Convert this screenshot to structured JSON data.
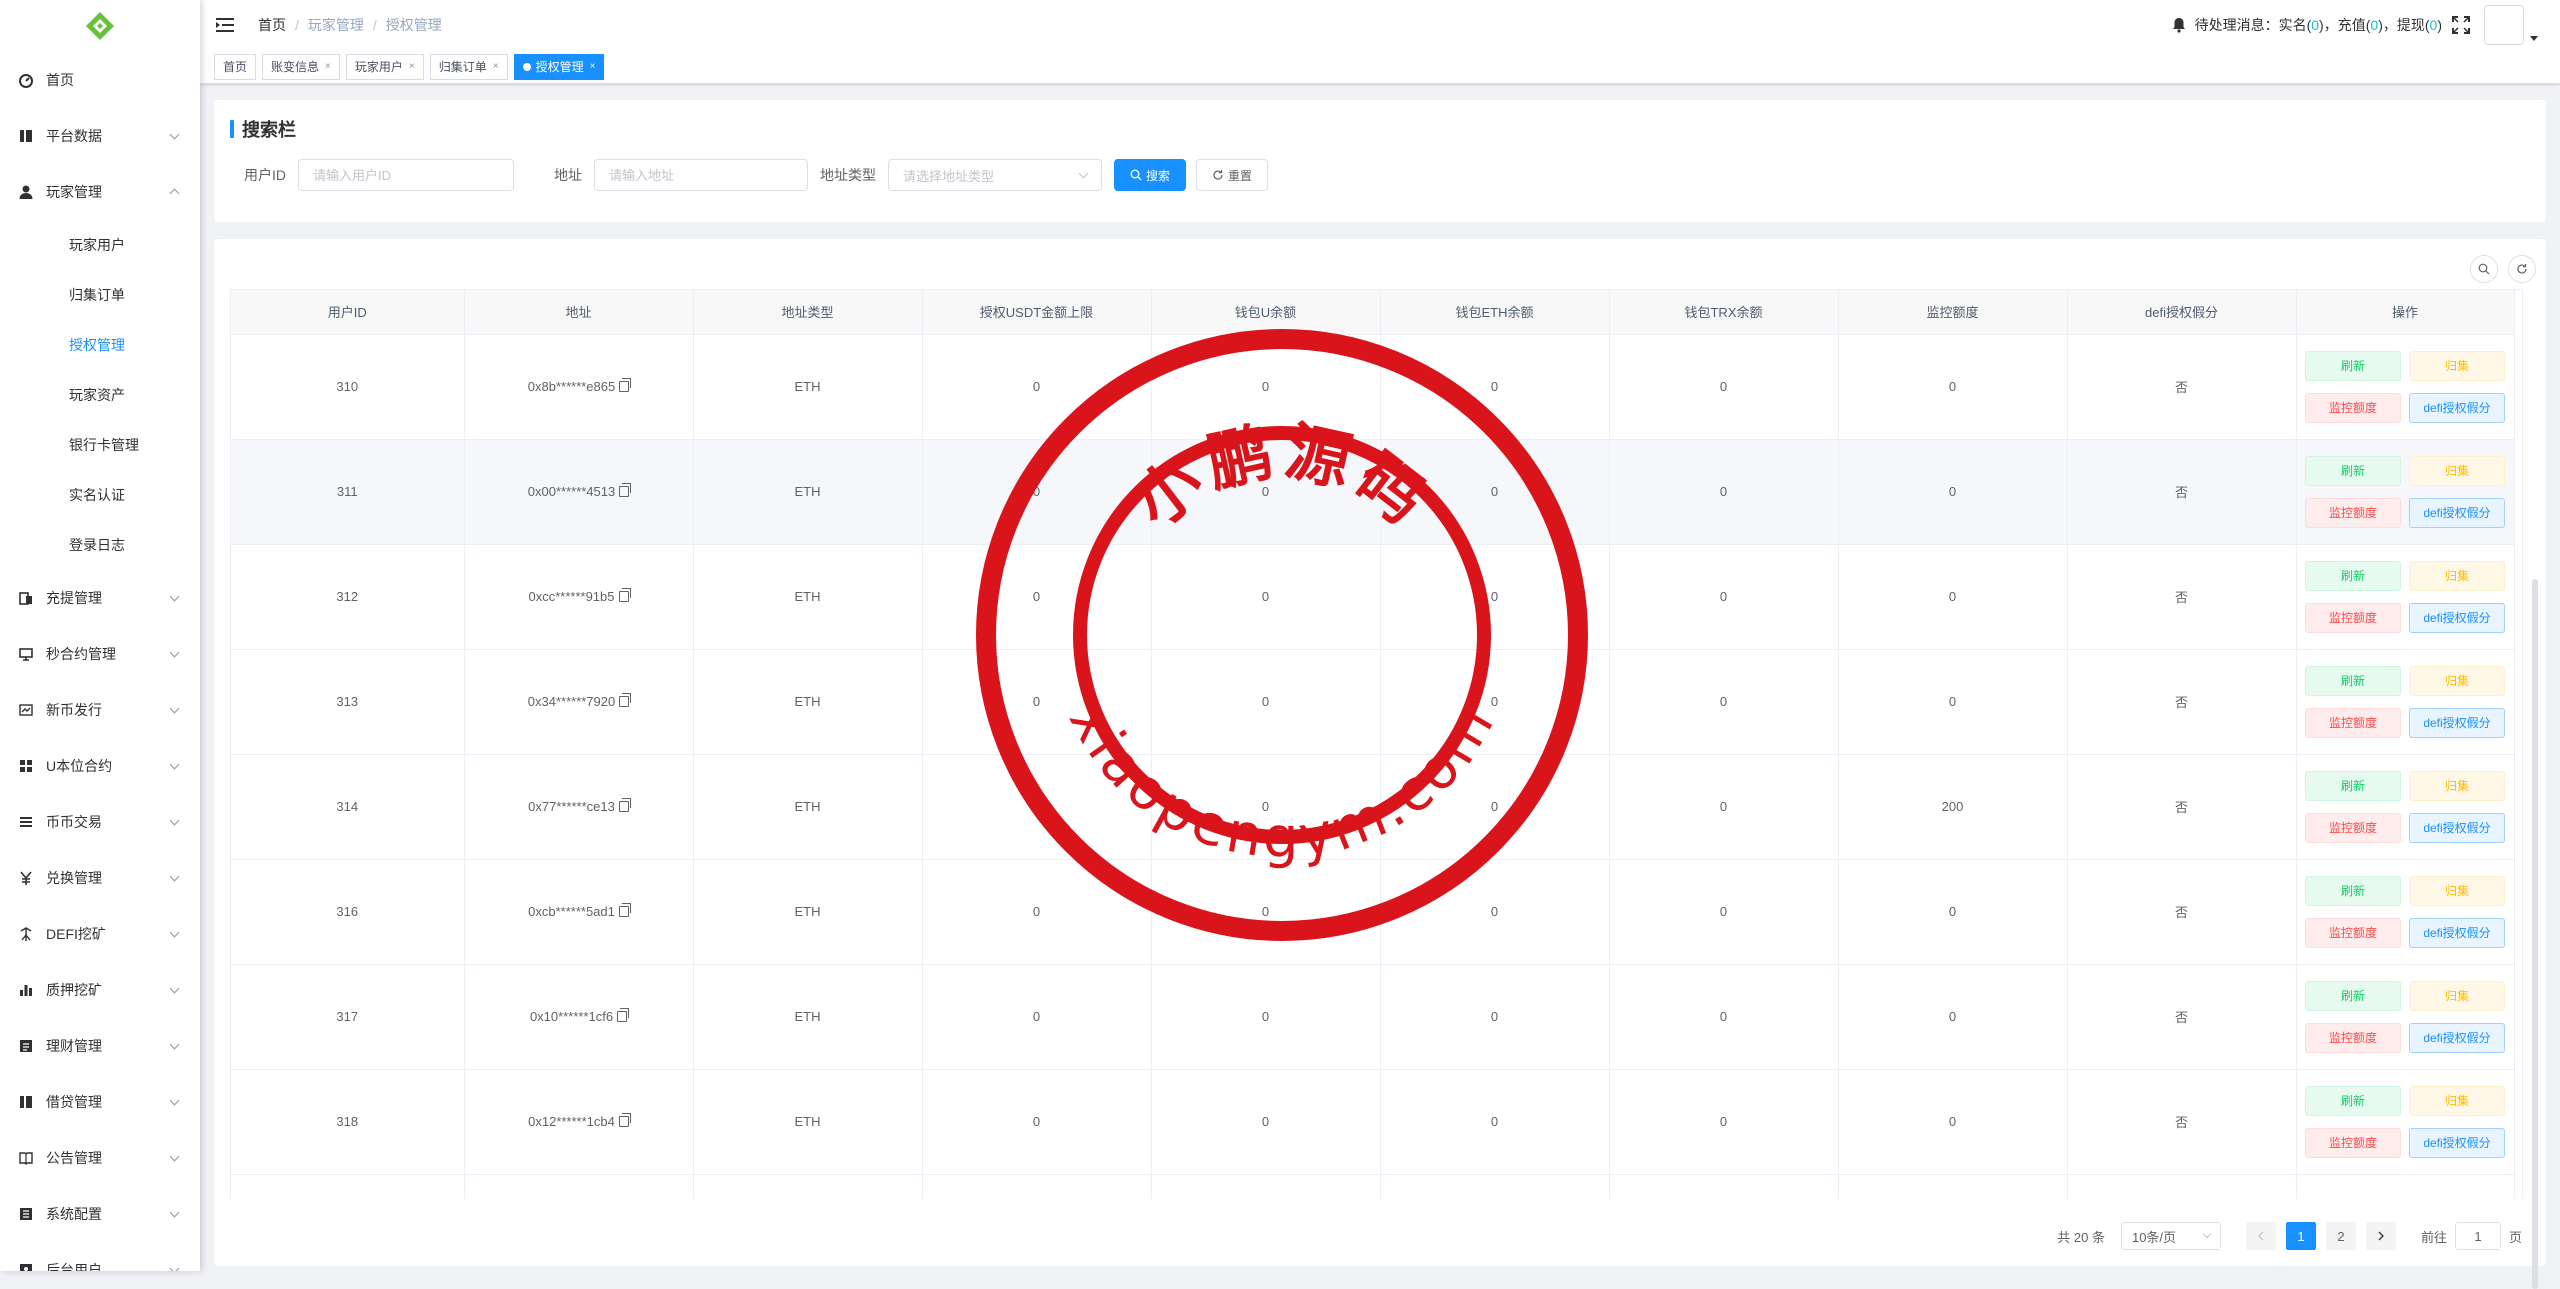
{
  "sidebar": {
    "items": [
      {
        "label": "首页",
        "icon": "dashboard-icon"
      },
      {
        "label": "平台数据",
        "icon": "data-icon"
      },
      {
        "label": "玩家管理",
        "icon": "user-icon"
      },
      {
        "label": "充提管理",
        "icon": "deposit-icon"
      },
      {
        "label": "秒合约管理",
        "icon": "contract-icon"
      },
      {
        "label": "新币发行",
        "icon": "coin-icon"
      },
      {
        "label": "U本位合约",
        "icon": "grid-icon"
      },
      {
        "label": "币币交易",
        "icon": "list-icon"
      },
      {
        "label": "兑换管理",
        "icon": "yen-icon"
      },
      {
        "label": "DEFI挖矿",
        "icon": "mining-icon"
      },
      {
        "label": "质押挖矿",
        "icon": "chart-icon"
      },
      {
        "label": "理财管理",
        "icon": "finance-icon"
      },
      {
        "label": "借贷管理",
        "icon": "loan-icon"
      },
      {
        "label": "公告管理",
        "icon": "book-icon"
      },
      {
        "label": "系统配置",
        "icon": "config-icon"
      },
      {
        "label": "后台用户",
        "icon": "admin-icon"
      }
    ],
    "player_sub": [
      "玩家用户",
      "归集订单",
      "授权管理",
      "玩家资产",
      "银行卡管理",
      "实名认证",
      "登录日志"
    ]
  },
  "navbar": {
    "breadcrumb": [
      "首页",
      "玩家管理",
      "授权管理"
    ],
    "notice_prefix": "待处理消息：",
    "notice_realname": "实名",
    "notice_recharge": "充值",
    "notice_withdraw": "提现",
    "count_realname": "0",
    "count_recharge": "0",
    "count_withdraw": "0"
  },
  "tags": [
    "首页",
    "账变信息",
    "玩家用户",
    "归集订单",
    "授权管理"
  ],
  "search": {
    "title": "搜索栏",
    "user_id_label": "用户ID",
    "user_id_placeholder": "请输入用户ID",
    "address_label": "地址",
    "address_placeholder": "请输入地址",
    "type_label": "地址类型",
    "type_placeholder": "请选择地址类型",
    "search_btn": "搜索",
    "reset_btn": "重置"
  },
  "table": {
    "columns": [
      "用户ID",
      "地址",
      "地址类型",
      "授权USDT金额上限",
      "钱包U余额",
      "钱包ETH余额",
      "钱包TRX余额",
      "监控额度",
      "defi授权假分",
      "操作"
    ],
    "rows": [
      {
        "id": "310",
        "addr": "0x8b******e865",
        "type": "ETH",
        "usdt": "0",
        "u": "0",
        "eth": "0",
        "trx": "0",
        "mon": "0",
        "defi": "否"
      },
      {
        "id": "311",
        "addr": "0x00******4513",
        "type": "ETH",
        "usdt": "0",
        "u": "0",
        "eth": "0",
        "trx": "0",
        "mon": "0",
        "defi": "否"
      },
      {
        "id": "312",
        "addr": "0xcc******91b5",
        "type": "ETH",
        "usdt": "0",
        "u": "0",
        "eth": "0",
        "trx": "0",
        "mon": "0",
        "defi": "否"
      },
      {
        "id": "313",
        "addr": "0x34******7920",
        "type": "ETH",
        "usdt": "0",
        "u": "0",
        "eth": "0",
        "trx": "0",
        "mon": "0",
        "defi": "否"
      },
      {
        "id": "314",
        "addr": "0x77******ce13",
        "type": "ETH",
        "usdt": "0",
        "u": "0",
        "eth": "0",
        "trx": "0",
        "mon": "200",
        "defi": "否"
      },
      {
        "id": "316",
        "addr": "0xcb******5ad1",
        "type": "ETH",
        "usdt": "0",
        "u": "0",
        "eth": "0",
        "trx": "0",
        "mon": "0",
        "defi": "否"
      },
      {
        "id": "317",
        "addr": "0x10******1cf6",
        "type": "ETH",
        "usdt": "0",
        "u": "0",
        "eth": "0",
        "trx": "0",
        "mon": "0",
        "defi": "否"
      },
      {
        "id": "318",
        "addr": "0x12******1cb4",
        "type": "ETH",
        "usdt": "0",
        "u": "0",
        "eth": "0",
        "trx": "0",
        "mon": "0",
        "defi": "否"
      }
    ],
    "op_refresh": "刷新",
    "op_collect": "归集",
    "op_monitor": "监控额度",
    "op_defi": "defi授权假分"
  },
  "pagination": {
    "total": "共 20 条",
    "page_size": "10条/页",
    "pages": [
      "1",
      "2"
    ],
    "goto": "前往",
    "current": "1",
    "page_unit": "页"
  },
  "watermark": {
    "top": "小鹏源码",
    "bottom": "xiaopengym.com",
    "color": "#d9141b"
  },
  "colors": {
    "accent": "#1890ff",
    "logo": "#67c23a"
  }
}
